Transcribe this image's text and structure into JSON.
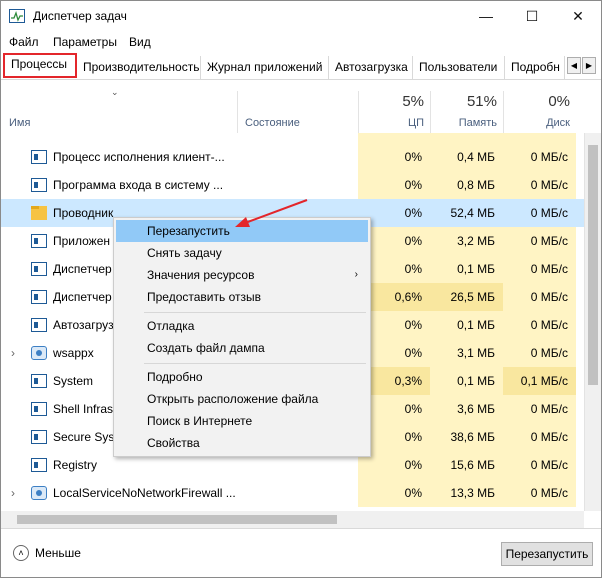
{
  "window": {
    "title": "Диспетчер задач",
    "minimize": "—",
    "maximize": "☐",
    "close": "✕"
  },
  "menu": [
    "Файл",
    "Параметры",
    "Вид"
  ],
  "tabs": [
    {
      "label": "Процессы",
      "active": true
    },
    {
      "label": "Производительность"
    },
    {
      "label": "Журнал приложений"
    },
    {
      "label": "Автозагрузка"
    },
    {
      "label": "Пользователи"
    },
    {
      "label": "Подробн"
    }
  ],
  "tab_scroll": {
    "left": "◀",
    "right": "▶"
  },
  "columns": {
    "name": "Имя",
    "status": "Состояние",
    "cpu": {
      "pct": "5%",
      "label": "ЦП"
    },
    "memory": {
      "pct": "51%",
      "label": "Память"
    },
    "disk": {
      "pct": "0%",
      "label": "Диск"
    }
  },
  "rows": [
    {
      "name": "Процесс исполнения клиент-...",
      "cpu": "0%",
      "mem": "0,4 МБ",
      "disk": "0 МБ/с",
      "icon": "window-icon"
    },
    {
      "name": "Программа входа в систему ...",
      "cpu": "0%",
      "mem": "0,8 МБ",
      "disk": "0 МБ/с",
      "icon": "window-icon"
    },
    {
      "name": "Проводник",
      "cpu": "0%",
      "mem": "52,4 МБ",
      "disk": "0 МБ/с",
      "icon": "folder-icon",
      "selected": true
    },
    {
      "name": "Приложен",
      "cpu": "0%",
      "mem": "3,2 МБ",
      "disk": "0 МБ/с",
      "icon": "window-icon"
    },
    {
      "name": "Диспетчер",
      "cpu": "0%",
      "mem": "0,1 МБ",
      "disk": "0 МБ/с",
      "icon": "window-icon"
    },
    {
      "name": "Диспетчер",
      "cpu": "0,6%",
      "mem": "26,5 МБ",
      "disk": "0 МБ/с",
      "icon": "window-icon",
      "hot": true
    },
    {
      "name": "Автозагрузу",
      "cpu": "0%",
      "mem": "0,1 МБ",
      "disk": "0 МБ/с",
      "icon": "window-icon"
    },
    {
      "name": "wsappx",
      "cpu": "0%",
      "mem": "3,1 МБ",
      "disk": "0 МБ/с",
      "icon": "gear-icon",
      "expandable": true
    },
    {
      "name": "System",
      "cpu": "0,3%",
      "mem": "0,1 МБ",
      "disk": "0,1 МБ/с",
      "icon": "window-icon",
      "hot": true
    },
    {
      "name": "Shell Infrast",
      "cpu": "0%",
      "mem": "3,6 МБ",
      "disk": "0 МБ/с",
      "icon": "window-icon"
    },
    {
      "name": "Secure Syst",
      "cpu": "0%",
      "mem": "38,6 МБ",
      "disk": "0 МБ/с",
      "icon": "window-icon"
    },
    {
      "name": "Registry",
      "cpu": "0%",
      "mem": "15,6 МБ",
      "disk": "0 МБ/с",
      "icon": "window-icon"
    },
    {
      "name": "LocalServiceNoNetworkFirewall ...",
      "cpu": "0%",
      "mem": "13,3 МБ",
      "disk": "0 МБ/с",
      "icon": "gear-icon",
      "expandable": true
    }
  ],
  "context_menu": [
    {
      "label": "Перезапустить",
      "hover": true
    },
    {
      "label": "Снять задачу"
    },
    {
      "label": "Значения ресурсов",
      "submenu": "›"
    },
    {
      "label": "Предоставить отзыв"
    },
    {
      "sep": true
    },
    {
      "label": "Отладка"
    },
    {
      "label": "Создать файл дампа"
    },
    {
      "sep": true
    },
    {
      "label": "Подробно"
    },
    {
      "label": "Открыть расположение файла"
    },
    {
      "label": "Поиск в Интернете"
    },
    {
      "label": "Свойства"
    }
  ],
  "footer": {
    "less_label": "Меньше",
    "less_icon": "˄",
    "restart_button": "Перезапустить"
  },
  "colors": {
    "selected_row": "#cce8ff",
    "heat": "#fff4c4",
    "tab_highlight": "#e3262b",
    "arrow": "#e3262b",
    "menu_hover": "#91c9f7"
  }
}
